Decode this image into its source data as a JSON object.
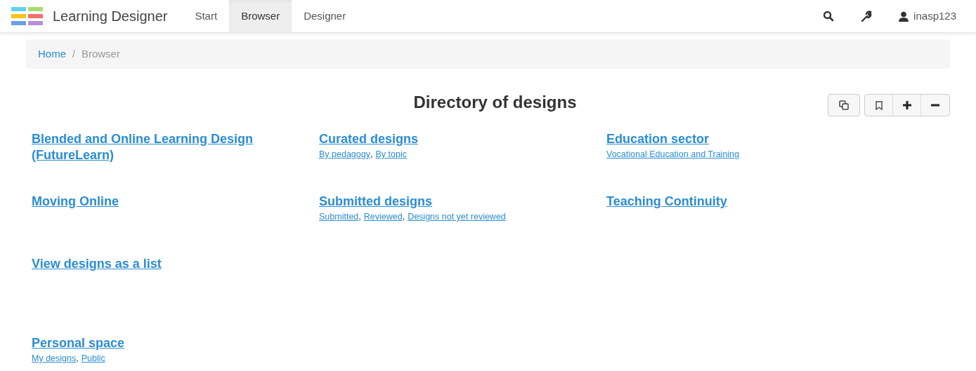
{
  "navbar": {
    "brand": "Learning Designer",
    "tabs": [
      {
        "label": "Start",
        "selected": false
      },
      {
        "label": "Browser",
        "selected": true
      },
      {
        "label": "Designer",
        "selected": false
      }
    ],
    "user": "inasp123"
  },
  "breadcrumb": [
    {
      "label": "Home",
      "kind": "link"
    },
    {
      "label": "/",
      "kind": "divider"
    },
    {
      "label": "Browser",
      "kind": "current"
    }
  ],
  "title": "Directory of designs",
  "separator": ",",
  "sections": [
    {
      "title": "Blended and Online Learning Design (FutureLearn)"
    },
    {
      "title": "Curated designs",
      "links": [
        "By pedagogy",
        "By topic"
      ]
    },
    {
      "title": "Education sector",
      "links": [
        "Vocational Education and Training"
      ]
    },
    {
      "title": "Moving Online"
    },
    {
      "title": "Submitted designs",
      "links": [
        "Submitted",
        "Reviewed",
        "Designs not yet reviewed"
      ]
    },
    {
      "title": "Teaching Continuity"
    },
    {
      "title": "View designs as a list"
    }
  ],
  "personal": {
    "title": "Personal space",
    "links": [
      "My designs",
      "Public"
    ]
  }
}
